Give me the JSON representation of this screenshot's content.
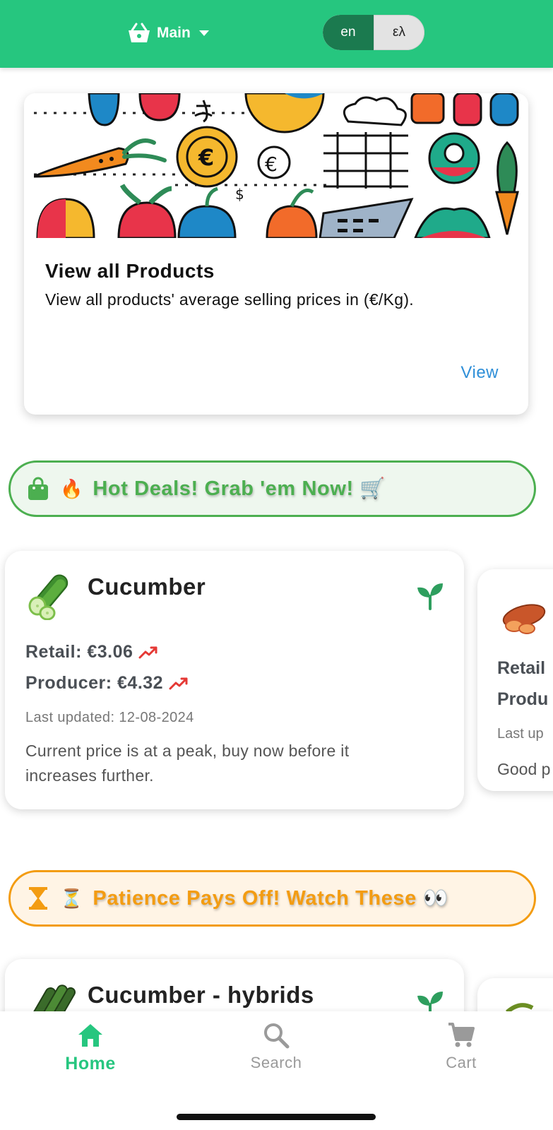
{
  "header": {
    "store_label": "Main",
    "languages": [
      {
        "code": "en",
        "active": true
      },
      {
        "code": "ελ",
        "active": false
      }
    ],
    "accent_color": "#26c67f"
  },
  "banner": {
    "title": "View all Products",
    "description": "View all products' average selling prices in (€/Kg).",
    "action": "View"
  },
  "hot_deals": {
    "title": "Hot Deals! Grab 'em Now! 🛒",
    "emoji": "🔥",
    "icon": "shopping-bag-icon",
    "color": "#4caf50",
    "products": [
      {
        "name": "Cucumber",
        "retail": "Retail: €3.06",
        "producer": "Producer: €4.32",
        "updated": "Last updated: 12-08-2024",
        "note": "Current price is at a peak, buy now before it increases further."
      }
    ],
    "peek": {
      "retail": "Retail",
      "producer": "Produ",
      "updated": "Last up",
      "note": "Good p"
    }
  },
  "watch": {
    "title": "Patience Pays Off! Watch These 👀",
    "emoji": "⏳",
    "icon": "hourglass-icon",
    "color": "#f39c12",
    "products": [
      {
        "name": "Cucumber - hybrids"
      }
    ]
  },
  "bottom_nav": {
    "items": [
      {
        "label": "Home",
        "icon": "home-icon",
        "active": true
      },
      {
        "label": "Search",
        "icon": "search-icon",
        "active": false
      },
      {
        "label": "Cart",
        "icon": "cart-icon",
        "active": false
      }
    ]
  }
}
